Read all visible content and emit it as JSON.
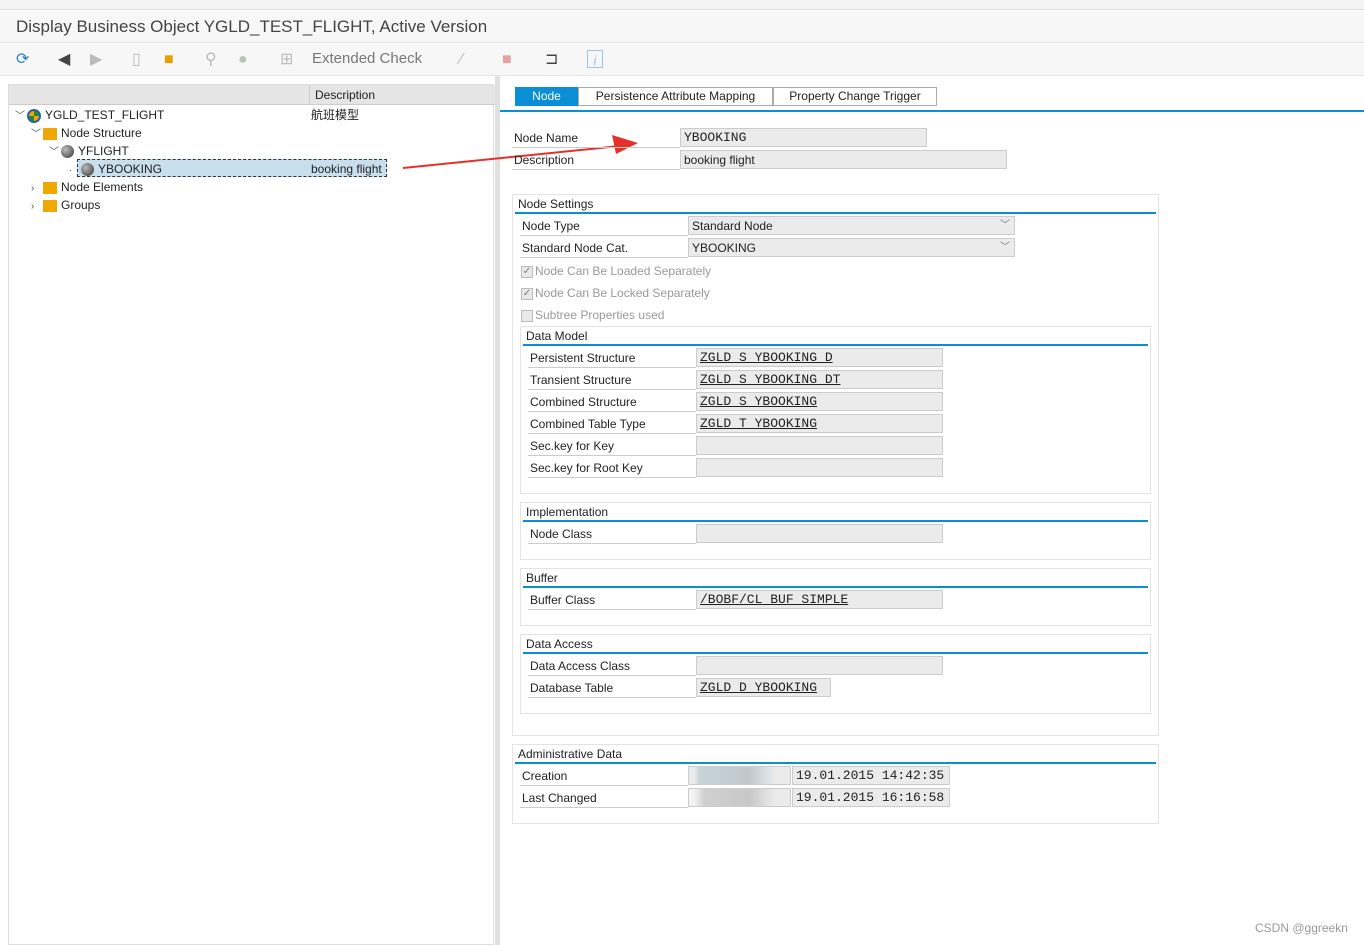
{
  "window": {
    "title": "Display Business Object YGLD_TEST_FLIGHT, Active Version"
  },
  "toolbar": {
    "extended_check": "Extended Check"
  },
  "tree": {
    "header_description": "Description",
    "items": [
      {
        "label": "YGLD_TEST_FLIGHT",
        "desc": "航班模型"
      },
      {
        "label": "Node Structure",
        "desc": ""
      },
      {
        "label": "YFLIGHT",
        "desc": ""
      },
      {
        "label": "YBOOKING",
        "desc": "booking flight"
      },
      {
        "label": "Node Elements",
        "desc": ""
      },
      {
        "label": "Groups",
        "desc": ""
      }
    ]
  },
  "tabs": [
    "Node",
    "Persistence Attribute Mapping",
    "Property Change Trigger"
  ],
  "node": {
    "name_label": "Node Name",
    "name": "YBOOKING",
    "desc_label": "Description",
    "desc": "booking flight"
  },
  "settings": {
    "title": "Node Settings",
    "type_label": "Node Type",
    "type": "Standard Node",
    "cat_label": "Standard Node Cat.",
    "cat": "YBOOKING",
    "chk1": "Node Can Be Loaded Separately",
    "chk2": "Node Can Be Locked Separately",
    "chk3": "Subtree Properties used"
  },
  "data_model": {
    "title": "Data Model",
    "rows": [
      {
        "label": "Persistent Structure",
        "value": "ZGLD_S_YBOOKING_D"
      },
      {
        "label": "Transient Structure",
        "value": "ZGLD_S_YBOOKING_DT"
      },
      {
        "label": "Combined Structure",
        "value": "ZGLD_S_YBOOKING"
      },
      {
        "label": "Combined Table Type",
        "value": "ZGLD_T_YBOOKING"
      },
      {
        "label": "Sec.key for Key",
        "value": ""
      },
      {
        "label": "Sec.key for Root Key",
        "value": ""
      }
    ]
  },
  "implementation": {
    "title": "Implementation",
    "label": "Node Class",
    "value": ""
  },
  "buffer": {
    "title": "Buffer",
    "label": "Buffer Class",
    "value": "/BOBF/CL_BUF_SIMPLE"
  },
  "data_access": {
    "title": "Data Access",
    "class_label": "Data Access Class",
    "class_value": "",
    "table_label": "Database Table",
    "table_value": "ZGLD_D_YBOOKING"
  },
  "admin": {
    "title": "Administrative Data",
    "creation_label": "Creation",
    "creation": "19.01.2015 14:42:35",
    "changed_label": "Last Changed",
    "changed": "19.01.2015 16:16:58"
  },
  "watermark": "CSDN @ggreekn"
}
